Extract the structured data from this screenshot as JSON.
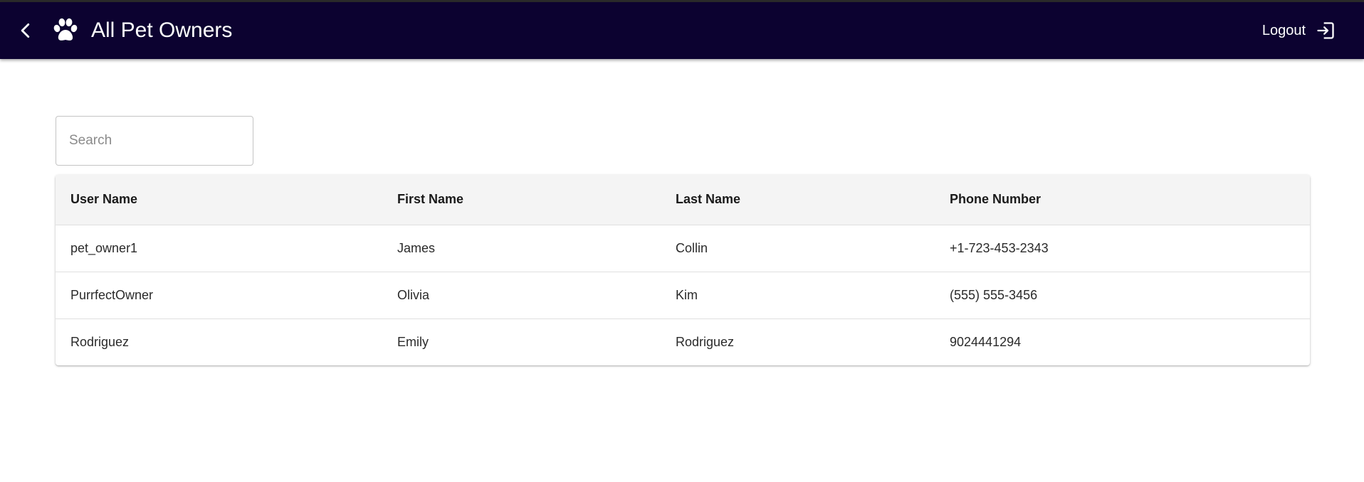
{
  "header": {
    "title": "All Pet Owners",
    "logout_label": "Logout",
    "background_color": "#0c0230",
    "icons": {
      "back": "chevron-left-icon",
      "logo": "paw-icon",
      "logout": "logout-icon"
    }
  },
  "search": {
    "placeholder": "Search",
    "value": ""
  },
  "table": {
    "columns": [
      "User Name",
      "First Name",
      "Last Name",
      "Phone Number"
    ],
    "rows": [
      [
        "pet_owner1",
        "James",
        "Collin",
        "+1-723-453-2343"
      ],
      [
        "PurrfectOwner",
        "Olivia",
        "Kim",
        "(555) 555-3456"
      ],
      [
        "Rodriguez",
        "Emily",
        "Rodriguez",
        "9024441294"
      ]
    ]
  }
}
